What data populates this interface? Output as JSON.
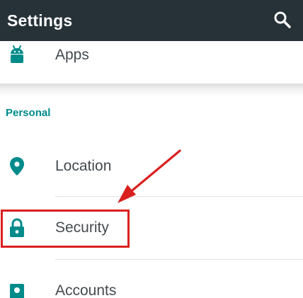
{
  "app_bar": {
    "title": "Settings",
    "search_icon": "search-icon",
    "background_color": "#263238"
  },
  "items_top": [
    {
      "label": "Apps",
      "icon": "android-icon"
    }
  ],
  "personal_section": {
    "header": "Personal",
    "header_color": "#008b8b",
    "items": [
      {
        "label": "Location",
        "icon": "location-pin-icon"
      },
      {
        "label": "Security",
        "icon": "lock-icon",
        "highlighted": true
      },
      {
        "label": "Accounts",
        "icon": "account-icon"
      }
    ]
  },
  "accent_color": "#008b8b",
  "annotation_color": "#d9201f"
}
